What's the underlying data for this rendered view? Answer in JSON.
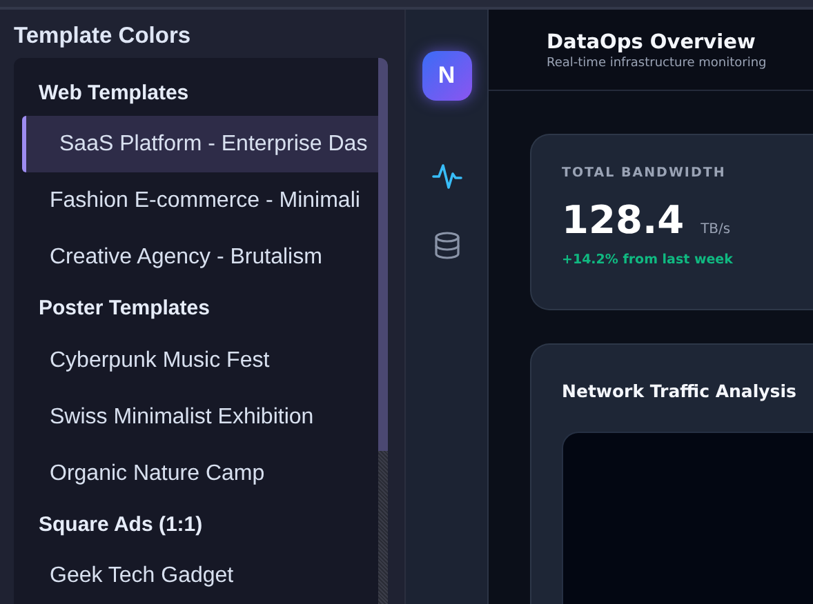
{
  "sidebar": {
    "title": "Template Colors",
    "groups": [
      {
        "label": "Web Templates",
        "items": [
          {
            "label": "SaaS Platform - Enterprise Das",
            "selected": true
          },
          {
            "label": "Fashion E-commerce - Minimali",
            "selected": false
          },
          {
            "label": "Creative Agency - Brutalism",
            "selected": false
          }
        ]
      },
      {
        "label": "Poster Templates",
        "items": [
          {
            "label": "Cyberpunk Music Fest",
            "selected": false
          },
          {
            "label": "Swiss Minimalist Exhibition",
            "selected": false
          },
          {
            "label": "Organic Nature Camp",
            "selected": false
          }
        ]
      },
      {
        "label": "Square Ads (1:1)",
        "items": [
          {
            "label": "Geek Tech Gadget",
            "selected": false
          }
        ]
      }
    ]
  },
  "nav_rail": {
    "logo": "N",
    "items": [
      {
        "kind": "pulse",
        "selected": true
      },
      {
        "kind": "database",
        "selected": false
      }
    ]
  },
  "header": {
    "title": "DataOps Overview",
    "subtitle": "Real-time infrastructure monitoring"
  },
  "stat_card": {
    "label": "TOTAL BANDWIDTH",
    "value": "128.4",
    "unit": "TB/s",
    "change": "+14.2% from last week"
  },
  "chart_card": {
    "title": "Network Traffic Analysis"
  }
}
